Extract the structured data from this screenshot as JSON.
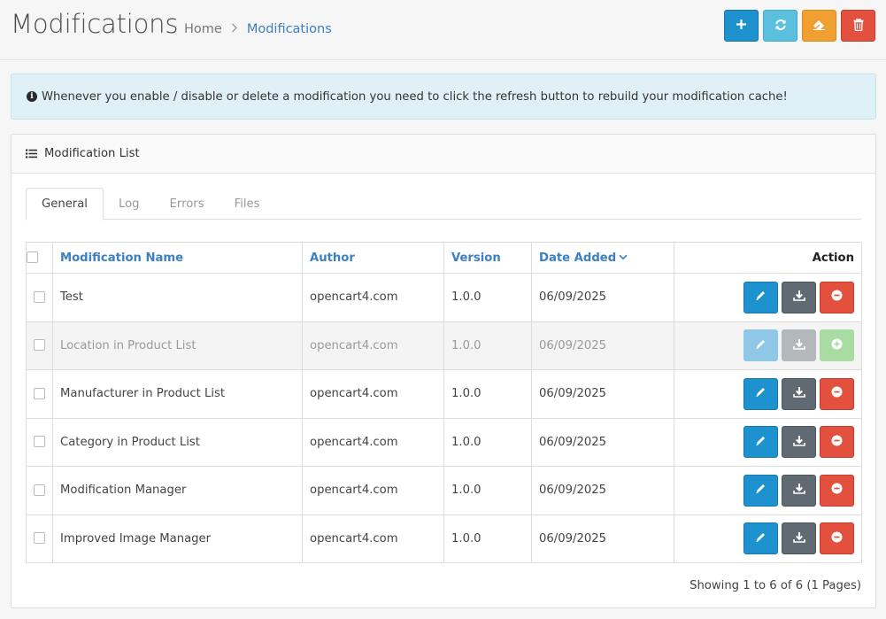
{
  "header": {
    "title": "Modifications",
    "breadcrumb": [
      {
        "label": "Home"
      },
      {
        "label": "Modifications"
      }
    ],
    "buttons": [
      {
        "icon": "plus-icon",
        "color": "#1e91cf"
      },
      {
        "icon": "refresh-icon",
        "color": "#5bc0de"
      },
      {
        "icon": "eraser-icon",
        "color": "#f0a030"
      },
      {
        "icon": "trash-icon",
        "color": "#e3503e"
      }
    ]
  },
  "alert": {
    "text": "Whenever you enable / disable or delete a modification you need to click the refresh button to rebuild your modification cache!"
  },
  "panel": {
    "heading": "Modification List",
    "tabs": [
      "General",
      "Log",
      "Errors",
      "Files"
    ],
    "active_tab": "General"
  },
  "table": {
    "columns": {
      "name": "Modification Name",
      "author": "Author",
      "version": "Version",
      "date_added": "Date Added",
      "action": "Action"
    },
    "rows": [
      {
        "name": "Test",
        "author": "opencart4.com",
        "version": "1.0.0",
        "date_added": "06/09/2025",
        "enabled": true
      },
      {
        "name": "Location in Product List",
        "author": "opencart4.com",
        "version": "1.0.0",
        "date_added": "06/09/2025",
        "enabled": false
      },
      {
        "name": "Manufacturer in Product List",
        "author": "opencart4.com",
        "version": "1.0.0",
        "date_added": "06/09/2025",
        "enabled": true
      },
      {
        "name": "Category in Product List",
        "author": "opencart4.com",
        "version": "1.0.0",
        "date_added": "06/09/2025",
        "enabled": true
      },
      {
        "name": "Modification Manager",
        "author": "opencart4.com",
        "version": "1.0.0",
        "date_added": "06/09/2025",
        "enabled": true
      },
      {
        "name": "Improved Image Manager",
        "author": "opencart4.com",
        "version": "1.0.0",
        "date_added": "06/09/2025",
        "enabled": true
      }
    ]
  },
  "pagination": {
    "text": "Showing 1 to 6 of 6 (1 Pages)"
  }
}
